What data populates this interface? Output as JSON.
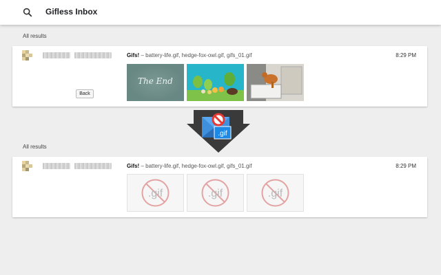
{
  "search": {
    "query": "Gifless Inbox",
    "icon": "search-icon"
  },
  "sections": [
    {
      "label": "All results"
    },
    {
      "label": "All results"
    }
  ],
  "emails": [
    {
      "subject_bold": "Gifs!",
      "subject_rest": " – battery-life.gif, hedge-fox-owl.gif, gifs_01.gif",
      "time": "8:29 PM",
      "back_label": "Back",
      "thumbnails": [
        {
          "text": "The End"
        },
        {
          "text": ""
        },
        {
          "text": ""
        }
      ]
    },
    {
      "subject_bold": "Gifs!",
      "subject_rest": " – battery-life.gif, hedge-fox-owl.gif, gifs_01.gif",
      "time": "8:29 PM",
      "placeholders": [
        {
          "text": ".gif"
        },
        {
          "text": ".gif"
        },
        {
          "text": ".gif"
        }
      ]
    }
  ],
  "logo": {
    "text": ".gif"
  },
  "colors": {
    "accent_red": "#e53935",
    "placeholder_red": "#e3a3a3",
    "arrow": "#3a3a3a"
  }
}
